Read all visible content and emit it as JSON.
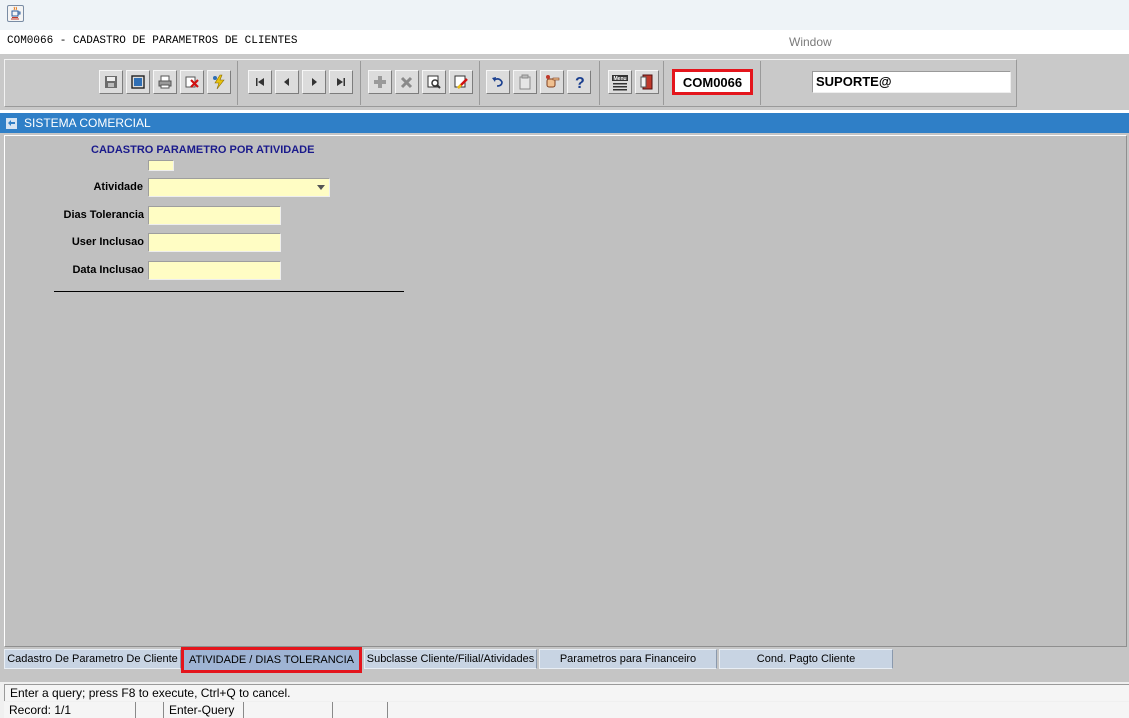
{
  "title_bar": {
    "icon": "java-coffee-icon"
  },
  "menu": {
    "form_caption": "COM0066 - CADASTRO DE PARAMETROS DE CLIENTES",
    "window_menu": "Window"
  },
  "toolbar": {
    "groups": [
      [
        "save-icon",
        "print-preview-icon",
        "print-icon",
        "exit-icon",
        "lightning-icon"
      ],
      [
        "first-record-icon",
        "previous-record-icon",
        "next-record-icon",
        "last-record-icon"
      ],
      [
        "insert-record-icon",
        "delete-record-icon",
        "enter-query-icon",
        "cancel-query-icon"
      ],
      [
        "undo-icon",
        "clipboard-icon",
        "hand-point-icon",
        "help-icon"
      ],
      [
        "menu-icon",
        "exit-door-icon"
      ]
    ],
    "form_code": "COM0066",
    "user": "SUPORTE@"
  },
  "window": {
    "title": "SISTEMA COMERCIAL"
  },
  "form": {
    "section_title": "CADASTRO PARAMETRO POR ATIVIDADE",
    "fields": {
      "atividade": {
        "label": "Atividade",
        "value": ""
      },
      "dias_tolerancia": {
        "label": "Dias Tolerancia",
        "value": ""
      },
      "user_inclusao": {
        "label": "User Inclusao",
        "value": ""
      },
      "data_inclusao": {
        "label": "Data Inclusao",
        "value": ""
      }
    }
  },
  "tabs": [
    {
      "label": "Cadastro De Parametro De Cliente",
      "active": false
    },
    {
      "label": "ATIVIDADE / DIAS TOLERANCIA",
      "active": true
    },
    {
      "label": "Subclasse Cliente/Filial/Atividades",
      "active": false
    },
    {
      "label": "Parametros para Financeiro",
      "active": false
    },
    {
      "label": "Cond. Pagto Cliente",
      "active": false
    }
  ],
  "status": {
    "message": "Enter a query;  press F8 to execute, Ctrl+Q to cancel.",
    "record": "Record: 1/1",
    "mode": "Enter-Query"
  },
  "colors": {
    "header_blue": "#2f7fc7",
    "field_yellow": "#fffdc4",
    "highlight_red": "#e4151c"
  }
}
